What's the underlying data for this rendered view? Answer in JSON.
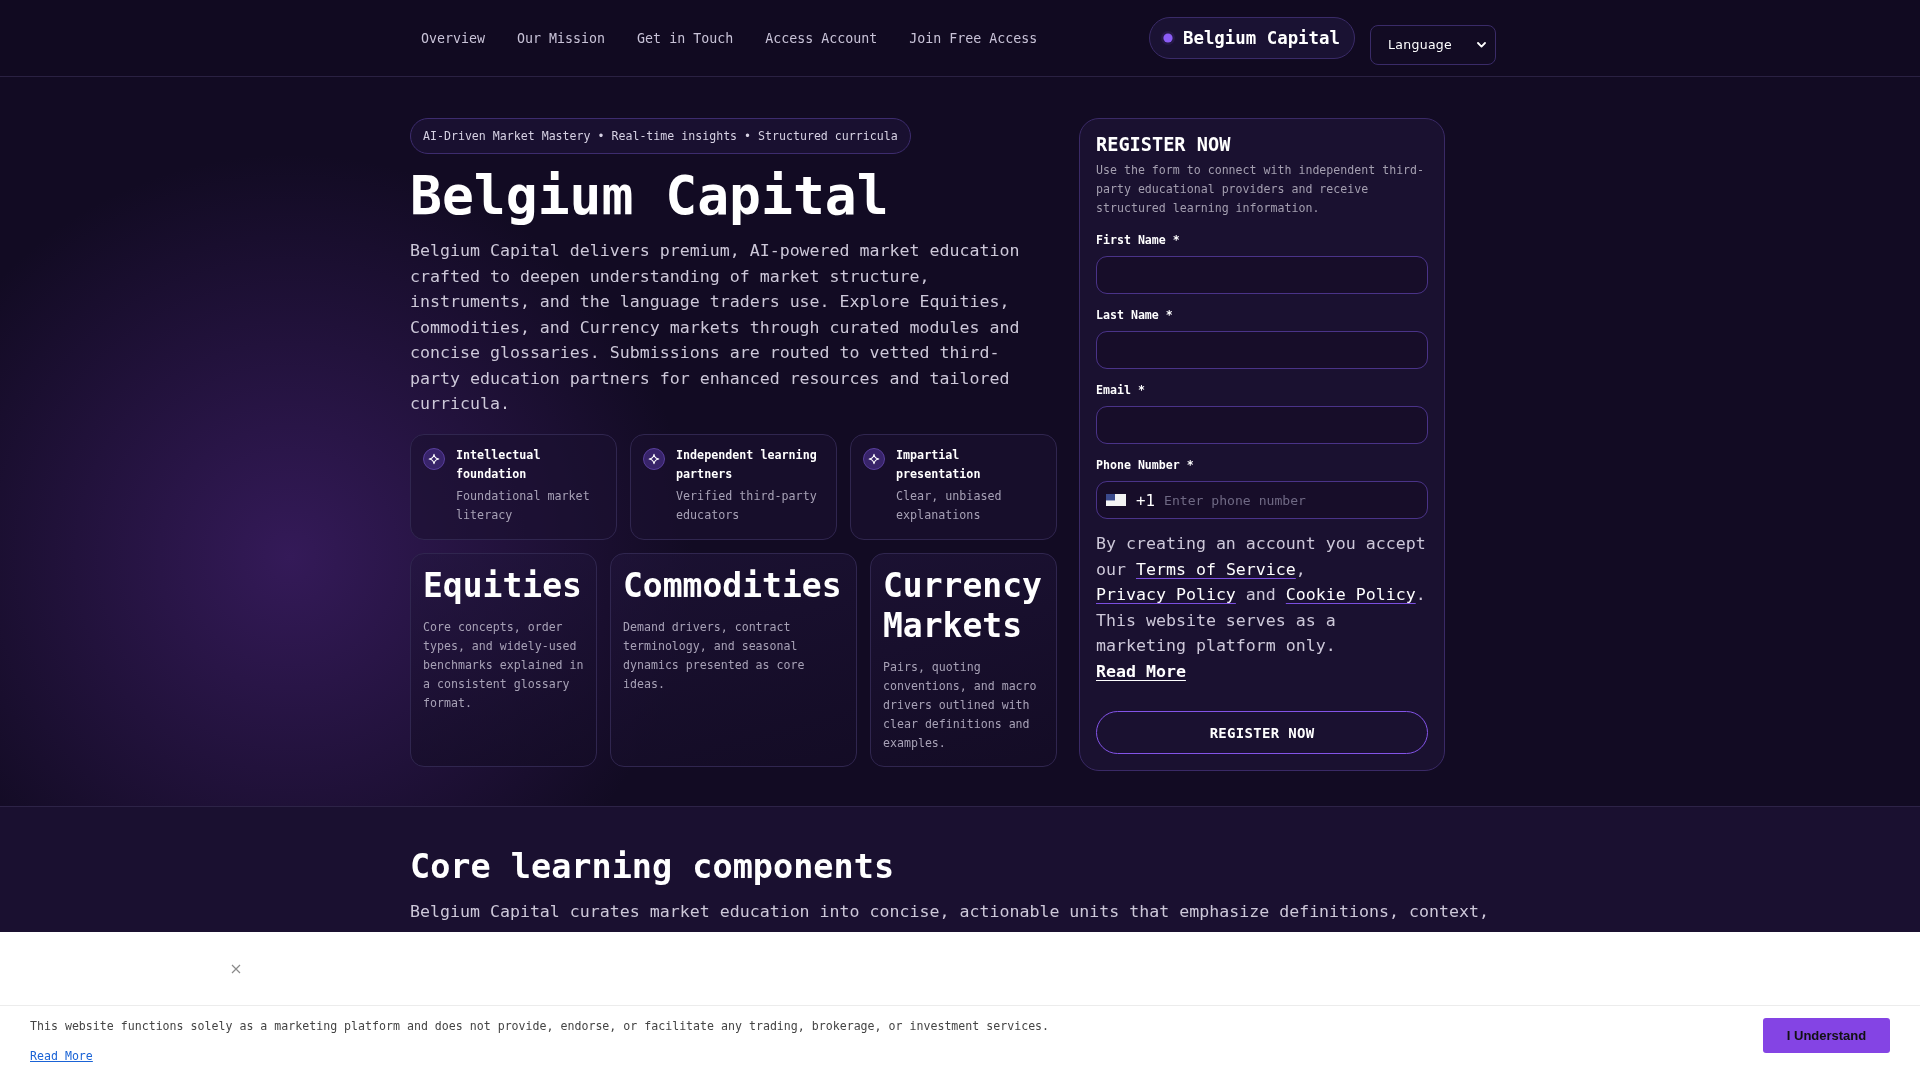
{
  "nav": {
    "links": [
      "Overview",
      "Our Mission",
      "Get in Touch",
      "Access Account",
      "Join Free Access"
    ],
    "brand": "Belgium Capital",
    "language": "Language"
  },
  "hero": {
    "tagline": "AI-Driven Market Mastery • Real-time insights • Structured curricula",
    "title": "Belgium Capital",
    "intro": "Belgium Capital delivers premium, AI-powered market education crafted to deepen understanding of market structure, instruments, and the language traders use. Explore Equities, Commodities, and Currency markets through curated modules and concise glossaries. Submissions are routed to vetted third-party education partners for enhanced resources and tailored curricula.",
    "features": [
      {
        "title": "Intellectual foundation",
        "text": "Foundational market literacy"
      },
      {
        "title": "Independent learning partners",
        "text": "Verified third-party educators"
      },
      {
        "title": "Impartial presentation",
        "text": "Clear, unbiased explanations"
      }
    ],
    "markets": [
      {
        "title": "Equities",
        "text": "Core concepts, order types, and widely-used benchmarks explained in a consistent glossary format."
      },
      {
        "title": "Commodities",
        "text": "Demand drivers, contract terminology, and seasonal dynamics presented as core ideas."
      },
      {
        "title": "Currency Markets",
        "text": "Pairs, quoting conventions, and macro drivers outlined with clear definitions and examples."
      }
    ]
  },
  "form": {
    "title": "REGISTER NOW",
    "description": "Use the form to connect with independent third-party educational providers and receive structured learning information.",
    "fields": [
      {
        "kind": "text",
        "label": "First Name *"
      },
      {
        "kind": "text",
        "label": "Last Name *"
      },
      {
        "kind": "text",
        "label": "Email *"
      },
      {
        "kind": "phone",
        "label": "Phone Number *",
        "country_code": "+1",
        "placeholder": "Enter phone number"
      }
    ],
    "consent": [
      {
        "kind": "text",
        "text": "By creating an account you accept our "
      },
      {
        "kind": "link",
        "text": "Terms of Service"
      },
      {
        "kind": "text",
        "text": ", "
      },
      {
        "kind": "link",
        "text": "Privacy Policy"
      },
      {
        "kind": "text",
        "text": " and "
      },
      {
        "kind": "link",
        "text": "Cookie Policy"
      },
      {
        "kind": "text",
        "text": ". This website serves as a marketing platform only. "
      },
      {
        "kind": "strong_link",
        "text": "Read More"
      }
    ],
    "submit": "REGISTER NOW"
  },
  "section": {
    "title": "Core learning components",
    "text": "Belgium Capital curates market education into concise, actionable units that emphasize definitions, context,"
  },
  "cookie_banner": {
    "message": "This website functions solely as a marketing platform and does not provide, endorse, or facilitate any trading, brokerage, or investment services.",
    "link": "Read More",
    "button": "I Understand"
  }
}
